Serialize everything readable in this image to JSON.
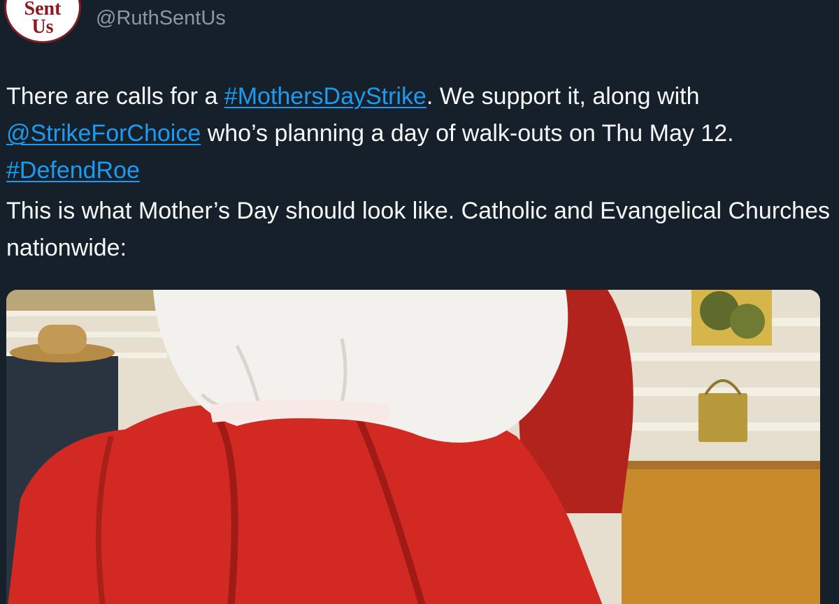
{
  "avatar": {
    "line1": "Sent",
    "line2": "Us"
  },
  "author": {
    "handle": "@RuthSentUs"
  },
  "tweet": {
    "p1_a": "There are calls for a ",
    "hashtag1": "#MothersDayStrike",
    "p1_b": ". We support it, along with ",
    "mention": "@StrikeForChoice",
    "p1_c": " who’s planning a day of walk-outs on Thu May 12. ",
    "hashtag2": "#DefendRoe",
    "p2": "This is what Mother’s Day should look like. Catholic and Evangelical Churches nationwide:"
  },
  "media": {
    "colors": {
      "cloak": "#d22a22",
      "bonnet": "#f3f1ee",
      "floor": "#c98a2c",
      "wall": "#e9e2d2"
    }
  }
}
